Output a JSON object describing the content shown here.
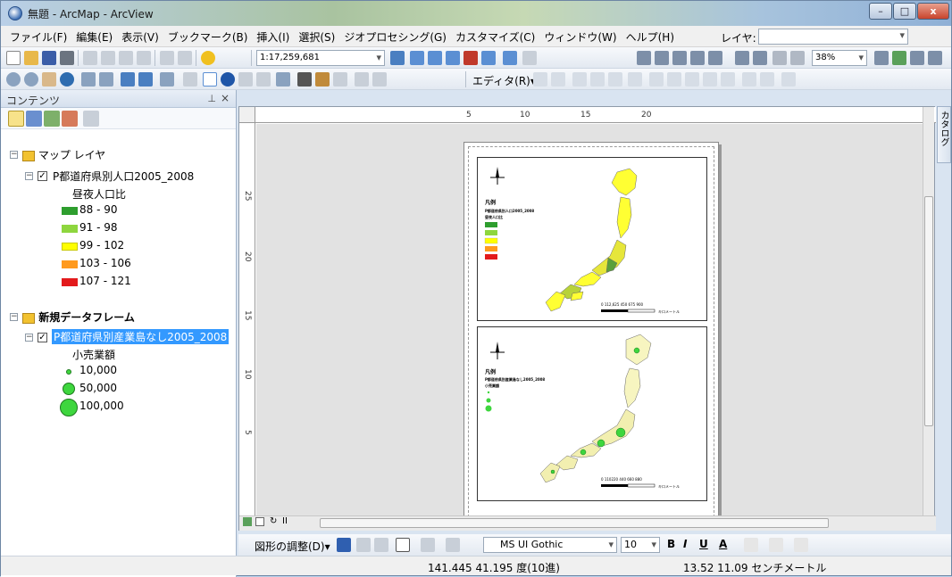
{
  "window": {
    "title": "無題 - ArcMap - ArcView",
    "buttons": {
      "minimize": "–",
      "maximize": "□",
      "close": "x"
    }
  },
  "menu": {
    "items": [
      "ファイル(F)",
      "編集(E)",
      "表示(V)",
      "ブックマーク(B)",
      "挿入(I)",
      "選択(S)",
      "ジオプロセシング(G)",
      "カスタマイズ(C)",
      "ウィンドウ(W)",
      "ヘルプ(H)"
    ],
    "layer_label": "レイヤ:",
    "layer_value": ""
  },
  "toolbar": {
    "scale": "1:17,259,681",
    "zoom": "38%",
    "editor_label": "エディタ(R)▾"
  },
  "toc": {
    "title": "コンテンツ",
    "pin": "⊥",
    "close": "×",
    "frame1": {
      "name": "マップ レイヤ",
      "layer": "P都道府県別人口2005_2008",
      "field": "昼夜人口比",
      "classes": [
        {
          "label": "88 - 90",
          "color": "#2e9e2e"
        },
        {
          "label": "91 - 98",
          "color": "#8ed63e"
        },
        {
          "label": "99 - 102",
          "color": "#ffff00"
        },
        {
          "label": "103 - 106",
          "color": "#ff9a1e"
        },
        {
          "label": "107 - 121",
          "color": "#e31a1c"
        }
      ]
    },
    "frame2": {
      "name": "新規データフレーム",
      "layer": "P都道府県別産業島なし2005_2008",
      "field": "小売業額",
      "classes": [
        {
          "label": "10,000",
          "size": 6
        },
        {
          "label": "50,000",
          "size": 14
        },
        {
          "label": "100,000",
          "size": 20
        }
      ]
    }
  },
  "rulers": {
    "top": [
      "5",
      "10",
      "15",
      "20"
    ],
    "left": [
      "25",
      "20",
      "15",
      "10",
      "5"
    ]
  },
  "catalog_tab": "カタログ",
  "draw_toolbar": {
    "label": "図形の調整(D)▾",
    "font": "MS UI Gothic",
    "size": "10",
    "bold": "B",
    "italic": "I",
    "underline": "U",
    "font_color": "A"
  },
  "status": {
    "coords": "141.445  41.195 度(10進)",
    "page_coords": "13.52  11.09 センチメートル"
  },
  "layout_page": {
    "map1": {
      "legend_title": "凡例",
      "legend_layer": "P都道府県別人口2005_2008",
      "legend_field": "昼夜人口比",
      "scalebar": "0  112,625  450  675  900",
      "scalebar_unit": "キロメートル"
    },
    "map2": {
      "legend_title": "凡例",
      "legend_layer": "P都道府県別産業島なし2005_2008",
      "legend_field": "小売業額",
      "scalebar": "0  110220  440  660  880",
      "scalebar_unit": "キロメートル"
    }
  }
}
